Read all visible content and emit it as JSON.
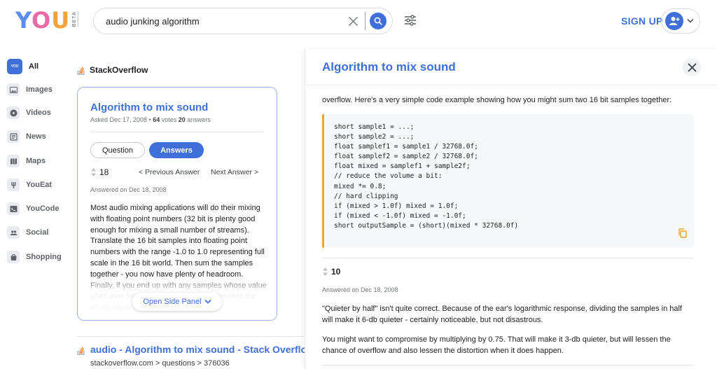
{
  "logo": {
    "text_y": "Y",
    "text_o": "O",
    "text_u": "U",
    "beta": "BETA"
  },
  "search": {
    "value": "audio junking algorithm"
  },
  "header": {
    "signup_label": "SIGN UP"
  },
  "sidebar": {
    "items": [
      {
        "label": "All",
        "icon": "you-icon",
        "icon_text": "YOU",
        "active": true
      },
      {
        "label": "Images",
        "icon": "image-icon"
      },
      {
        "label": "Videos",
        "icon": "video-icon"
      },
      {
        "label": "News",
        "icon": "news-icon"
      },
      {
        "label": "Maps",
        "icon": "map-icon"
      },
      {
        "label": "YouEat",
        "icon": "fork-icon"
      },
      {
        "label": "YouCode",
        "icon": "code-icon"
      },
      {
        "label": "Social",
        "icon": "people-icon"
      },
      {
        "label": "Shopping",
        "icon": "bag-icon"
      }
    ]
  },
  "main": {
    "source_label": "StackOverflow",
    "card": {
      "title": "Algorithm to mix sound",
      "asked": "Asked Dec 17, 2008 •",
      "votes_num": "64",
      "votes_word": " votes ",
      "answers_num": "20",
      "answers_word": " answers",
      "tab_question": "Question",
      "tab_answers": "Answers",
      "vote_count": "18",
      "prev_answer": "< Previous Answer",
      "next_answer": "Next Answer >",
      "answered": "Answered on Dec 18, 2008",
      "body": "Most audio mixing applications will do their mixing with floating point numbers (32 bit is plenty good enough for mixing a small number of streams). Translate the 16 bit samples into floating point numbers with the range -1.0 to 1.0 representing full scale in the 16 bit world. Then sum the samples together - you now have plenty of headroom. Finally, if you end up with any samples whose value goes over full scale, you can either attenuate the whole signal or use hard clipping.",
      "open_panel": "Open Side Panel"
    },
    "result2": {
      "title": "audio - Algorithm to mix sound - Stack Overflow",
      "url": "stackoverflow.com > questions > 376036"
    }
  },
  "panel": {
    "title": "Algorithm to mix sound",
    "intro": "overflow. Here's a very simple code example showing how you might sum two 16 bit samples together:",
    "code": "short sample1 = ...;\nshort sample2 = ...;\nfloat samplef1 = sample1 / 32768.0f;\nfloat samplef2 = sample2 / 32768.0f;\nfloat mixed = samplef1 + sample2f;\n// reduce the volume a bit:\nmixed *= 0.8;\n// hard clipping\nif (mixed > 1.0f) mixed = 1.0f;\nif (mixed < -1.0f) mixed = -1.0f;\nshort outputSample = (short)(mixed * 32768.0f)",
    "vote_count": "10",
    "answered": "Answered on Dec 18, 2008",
    "text1": "\"Quieter by half\" isn't quite correct. Because of the ear's logarithmic response, dividing the samples in half will make it 6-db quieter - certainly noticeable, but not disastrous.",
    "text2": "You might want to compromise by multiplying by 0.75. That will make it 3-db quieter, but will lessen the chance of overflow and also lessen the distortion when it does happen."
  },
  "colors": {
    "accent": "#3f6fd8",
    "code_border": "#f0a430"
  }
}
